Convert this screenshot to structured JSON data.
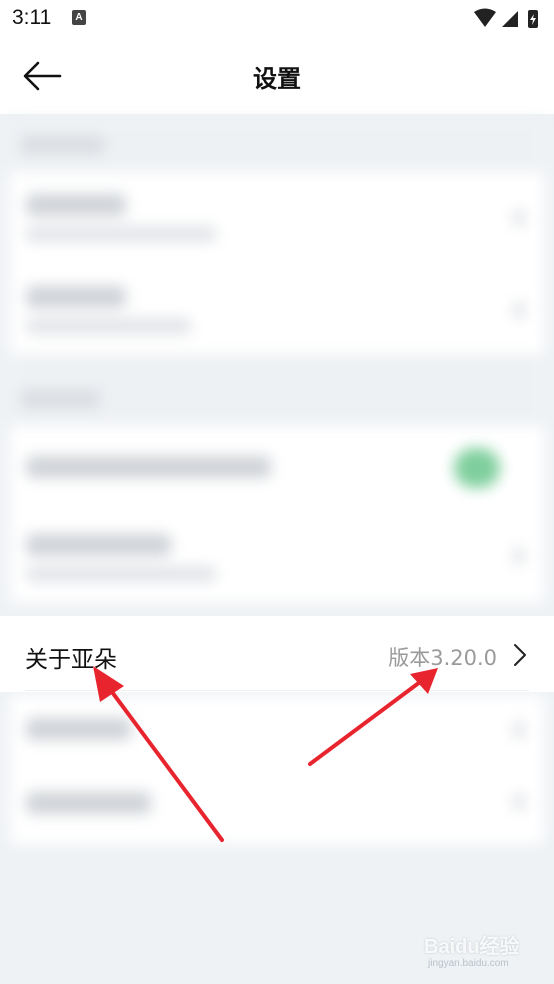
{
  "status_bar": {
    "time": "3:11",
    "notification_icon": "A"
  },
  "app_bar": {
    "title": "设置",
    "back_icon": "arrow-left-icon"
  },
  "about_row": {
    "label": "关于亚朵",
    "version": "版本3.20.0",
    "chevron_icon": "chevron-right-icon"
  },
  "annotation": {
    "arrow_color": "#e8252e"
  },
  "watermark": {
    "brand": "Baidu经验",
    "url": "jingyan.baidu.com"
  }
}
